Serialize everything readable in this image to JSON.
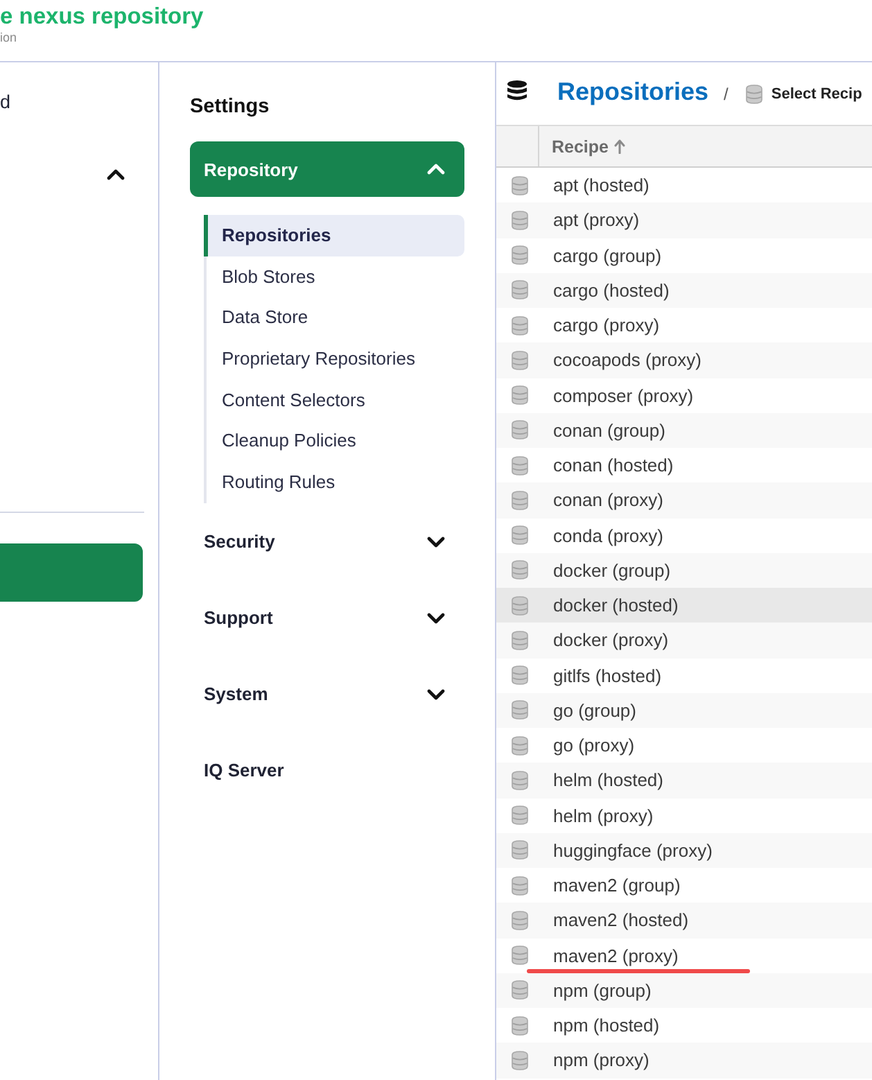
{
  "header": {
    "title": "e nexus repository",
    "subtitle": "ion"
  },
  "left_nav": {
    "items": [
      {
        "kind": "link",
        "label": "d"
      },
      {
        "kind": "group",
        "expanded": true
      }
    ],
    "active_item": {
      "selected": true
    }
  },
  "settings": {
    "title": "Settings",
    "groups": [
      {
        "kind": "group",
        "label": "Repository",
        "selected": true,
        "expanded": true,
        "children": [
          {
            "label": "Repositories",
            "selected": true
          },
          {
            "label": "Blob Stores",
            "selected": false
          },
          {
            "label": "Data Store",
            "selected": false
          },
          {
            "label": "Proprietary Repositories",
            "selected": false
          },
          {
            "label": "Content Selectors",
            "selected": false
          },
          {
            "label": "Cleanup Policies",
            "selected": false
          },
          {
            "label": "Routing Rules",
            "selected": false
          }
        ]
      },
      {
        "kind": "group",
        "label": "Security",
        "selected": false,
        "expanded": false
      },
      {
        "kind": "group",
        "label": "Support",
        "selected": false,
        "expanded": false
      },
      {
        "kind": "group",
        "label": "System",
        "selected": false,
        "expanded": false
      },
      {
        "kind": "link",
        "label": "IQ Server",
        "selected": false
      }
    ]
  },
  "main": {
    "title": "Repositories",
    "separator": "/",
    "breadcrumb": "Select Recip",
    "table": {
      "columns": [
        {
          "label": "Recipe",
          "sort_ascending": true
        }
      ],
      "rows": [
        {
          "recipe": "apt (hosted)",
          "selected": false,
          "underlined": false
        },
        {
          "recipe": "apt (proxy)",
          "selected": false,
          "underlined": false
        },
        {
          "recipe": "cargo (group)",
          "selected": false,
          "underlined": false
        },
        {
          "recipe": "cargo (hosted)",
          "selected": false,
          "underlined": false
        },
        {
          "recipe": "cargo (proxy)",
          "selected": false,
          "underlined": false
        },
        {
          "recipe": "cocoapods (proxy)",
          "selected": false,
          "underlined": false
        },
        {
          "recipe": "composer (proxy)",
          "selected": false,
          "underlined": false
        },
        {
          "recipe": "conan (group)",
          "selected": false,
          "underlined": false
        },
        {
          "recipe": "conan (hosted)",
          "selected": false,
          "underlined": false
        },
        {
          "recipe": "conan (proxy)",
          "selected": false,
          "underlined": false
        },
        {
          "recipe": "conda (proxy)",
          "selected": false,
          "underlined": false
        },
        {
          "recipe": "docker (group)",
          "selected": false,
          "underlined": false
        },
        {
          "recipe": "docker (hosted)",
          "selected": true,
          "underlined": false
        },
        {
          "recipe": "docker (proxy)",
          "selected": false,
          "underlined": false
        },
        {
          "recipe": "gitlfs (hosted)",
          "selected": false,
          "underlined": false
        },
        {
          "recipe": "go (group)",
          "selected": false,
          "underlined": false
        },
        {
          "recipe": "go (proxy)",
          "selected": false,
          "underlined": false
        },
        {
          "recipe": "helm (hosted)",
          "selected": false,
          "underlined": false
        },
        {
          "recipe": "helm (proxy)",
          "selected": false,
          "underlined": false
        },
        {
          "recipe": "huggingface (proxy)",
          "selected": false,
          "underlined": false
        },
        {
          "recipe": "maven2 (group)",
          "selected": false,
          "underlined": false
        },
        {
          "recipe": "maven2 (hosted)",
          "selected": false,
          "underlined": false
        },
        {
          "recipe": "maven2 (proxy)",
          "selected": false,
          "underlined": true
        },
        {
          "recipe": "npm (group)",
          "selected": false,
          "underlined": false
        },
        {
          "recipe": "npm (hosted)",
          "selected": false,
          "underlined": false
        },
        {
          "recipe": "npm (proxy)",
          "selected": false,
          "underlined": false
        }
      ]
    }
  }
}
